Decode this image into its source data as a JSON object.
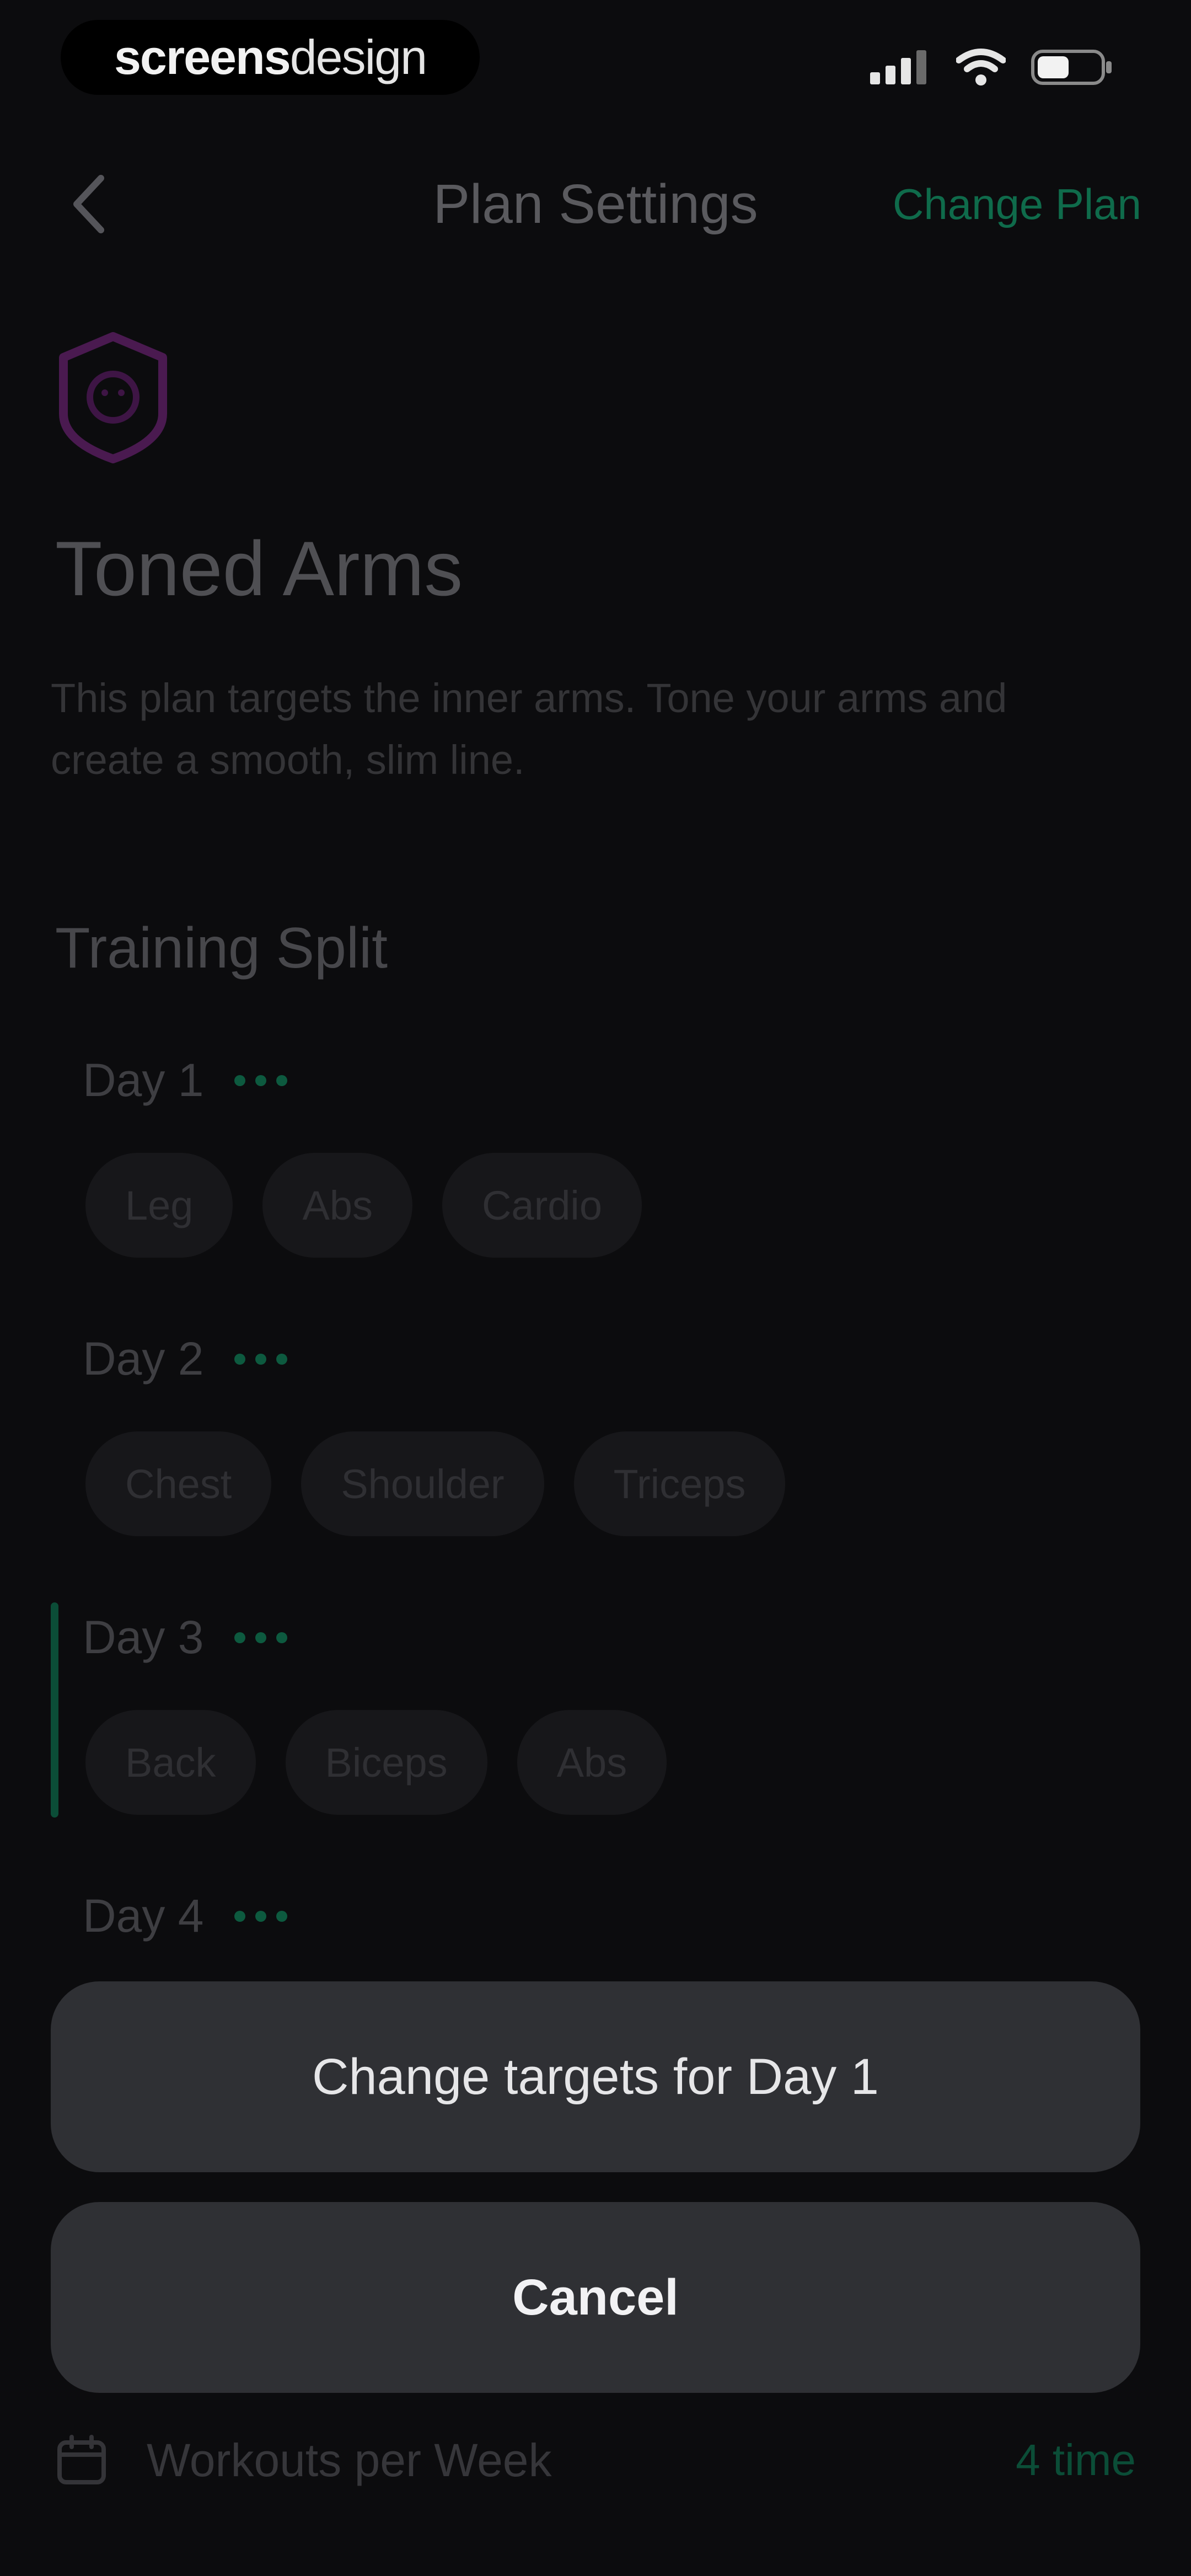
{
  "status_bar": {
    "brand_bold": "screens",
    "brand_light": "design"
  },
  "header": {
    "title": "Plan Settings",
    "action_label": "Change Plan"
  },
  "plan": {
    "title": "Toned Arms",
    "description": "This plan targets the inner arms. Tone your arms and create a smooth, slim line."
  },
  "training_split": {
    "title": "Training Split",
    "days": [
      {
        "label": "Day 1",
        "targets": [
          "Leg",
          "Abs",
          "Cardio"
        ]
      },
      {
        "label": "Day 2",
        "targets": [
          "Chest",
          "Shoulder",
          "Triceps"
        ]
      },
      {
        "label": "Day 3",
        "targets": [
          "Back",
          "Biceps",
          "Abs"
        ]
      },
      {
        "label": "Day 4",
        "targets": []
      }
    ]
  },
  "sheet": {
    "change_label": "Change targets for Day 1",
    "cancel_label": "Cancel"
  },
  "workouts": {
    "label": "Workouts per Week",
    "value": "4 time"
  },
  "colors": {
    "background": "#0c0c0e",
    "accent": "#0f6b4b",
    "sheet_button": "#2f3034"
  }
}
